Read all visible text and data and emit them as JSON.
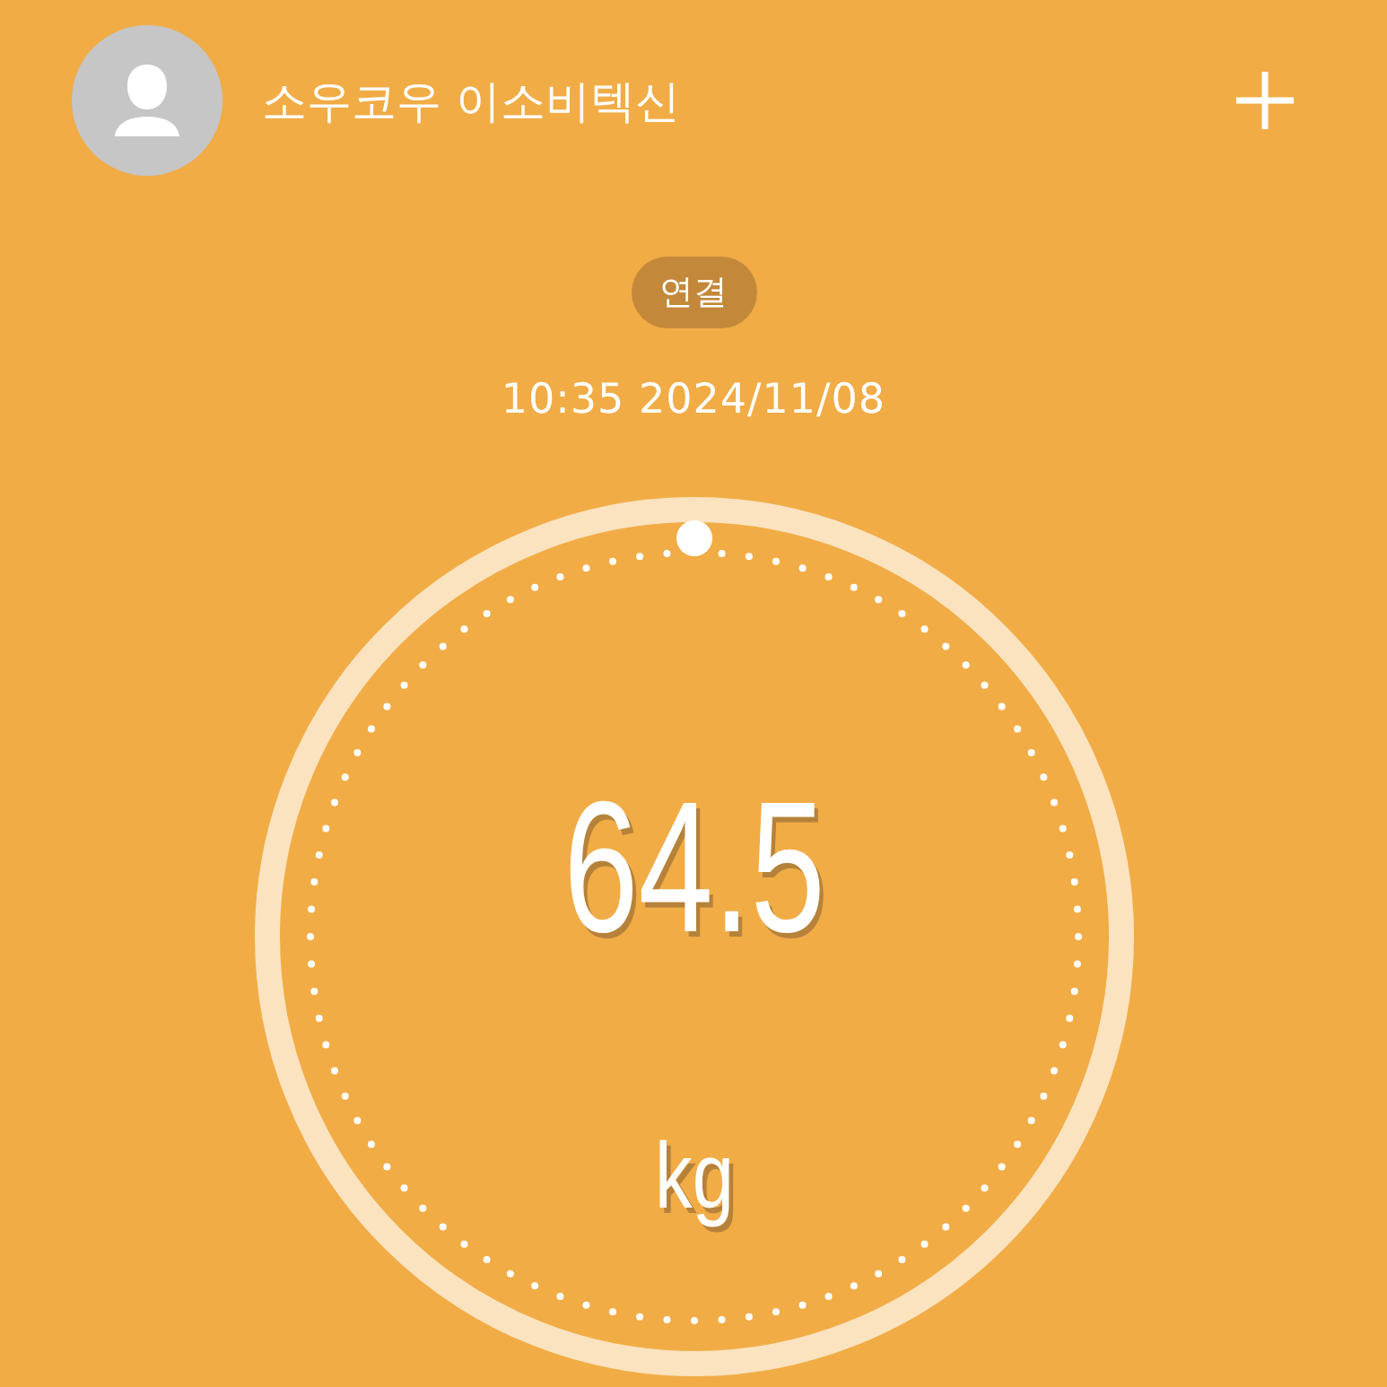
{
  "header": {
    "user_name": "소우코우 이소비텍신"
  },
  "status": {
    "badge": "연결",
    "timestamp": "10:35 2024/11/08"
  },
  "reading": {
    "value": "64.5",
    "unit": "kg"
  }
}
